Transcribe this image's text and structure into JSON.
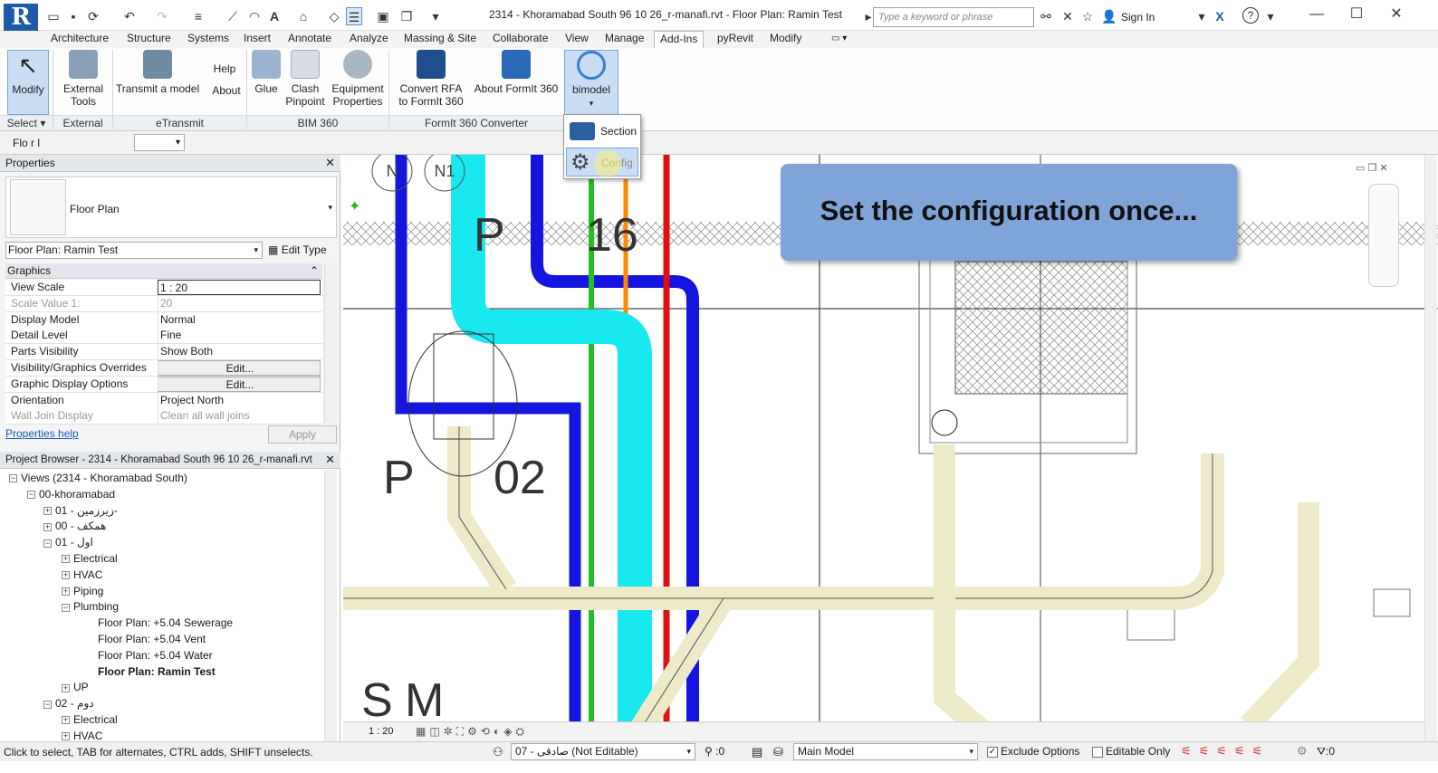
{
  "app": {
    "logo": "R",
    "document_title": "2314 - Khoramabad South 96 10 26_r-manafi.rvt - Floor Plan: Ramin Test",
    "search_placeholder": "Type a keyword or phrase",
    "sign_in": "Sign In"
  },
  "menu": [
    "Architecture",
    "Structure",
    "Systems",
    "Insert",
    "Annotate",
    "Analyze",
    "Massing & Site",
    "Collaborate",
    "View",
    "Manage",
    "Add-Ins",
    "pyRevit",
    "Modify"
  ],
  "menu_active": "Add-Ins",
  "ribbon": {
    "modify": "Modify",
    "external_tools": "External Tools",
    "transmit": "Transmit a model",
    "help": "Help",
    "about": "About",
    "glue": "Glue",
    "clash": "Clash Pinpoint",
    "equipment": "Equipment Properties",
    "convert_rfa": "Convert RFA to FormIt 360",
    "about_formit": "About FormIt 360",
    "bimodel": "bimodel",
    "groups": {
      "select": "Select",
      "external": "External",
      "etransmit": "eTransmit",
      "bim360": "BIM 360",
      "formit": "FormIt 360 Converter"
    }
  },
  "dropdown": {
    "section": "Section",
    "config": "Config"
  },
  "options_bar": {
    "label": "Flo r l"
  },
  "properties": {
    "title": "Properties",
    "type_name": "Floor Plan",
    "instance": "Floor Plan: Ramin Test",
    "edit_type": "Edit Type",
    "section": "Graphics",
    "rows": [
      {
        "k": "View Scale",
        "v": "1 : 20"
      },
      {
        "k": "Scale Value    1:",
        "v": "20"
      },
      {
        "k": "Display Model",
        "v": "Normal"
      },
      {
        "k": "Detail Level",
        "v": "Fine"
      },
      {
        "k": "Parts Visibility",
        "v": "Show Both"
      },
      {
        "k": "Visibility/Graphics Overrides",
        "v": "Edit..."
      },
      {
        "k": "Graphic Display Options",
        "v": "Edit..."
      },
      {
        "k": "Orientation",
        "v": "Project North"
      },
      {
        "k": "Wall Join Display",
        "v": "Clean all wall joins"
      }
    ],
    "help_link": "Properties help",
    "apply": "Apply"
  },
  "browser": {
    "title": "Project Browser - 2314 - Khoramabad South 96 10 26_r-manafi.rvt",
    "nodes": [
      {
        "label": "Views (2314 - Khoramabad South)",
        "exp": "−"
      },
      {
        "label": "00-khoramabad",
        "exp": "−"
      },
      {
        "label": "زیرزمین - 01-",
        "exp": "+"
      },
      {
        "label": "همکف - 00",
        "exp": "+"
      },
      {
        "label": "اول - 01",
        "exp": "−"
      },
      {
        "label": "Electrical",
        "exp": "+"
      },
      {
        "label": "HVAC",
        "exp": "+"
      },
      {
        "label": "Piping",
        "exp": "+"
      },
      {
        "label": "Plumbing",
        "exp": "−"
      },
      {
        "label": "Floor Plan: +5.04 Sewerage",
        "exp": ""
      },
      {
        "label": "Floor Plan: +5.04 Vent",
        "exp": ""
      },
      {
        "label": "Floor Plan: +5.04 Water",
        "exp": ""
      },
      {
        "label": "Floor Plan: Ramin Test",
        "exp": ""
      },
      {
        "label": "UP",
        "exp": "+"
      },
      {
        "label": "دوم - 02",
        "exp": "−"
      },
      {
        "label": "Electrical",
        "exp": "+"
      },
      {
        "label": "HVAC",
        "exp": "+"
      }
    ]
  },
  "canvas": {
    "tags": [
      "N",
      "N1",
      "P",
      "16",
      "P",
      "02",
      "S",
      "M"
    ],
    "view_scale": "1 : 20"
  },
  "tooltip": "Set the configuration once...",
  "status": {
    "hint": "Click to select, TAB for alternates, CTRL adds, SHIFT unselects.",
    "workset": "07 - صادقی (Not Editable)",
    "count": ":0",
    "model": "Main Model",
    "exclude": "Exclude Options",
    "editable_only": "Editable Only",
    "filter": ":0"
  }
}
